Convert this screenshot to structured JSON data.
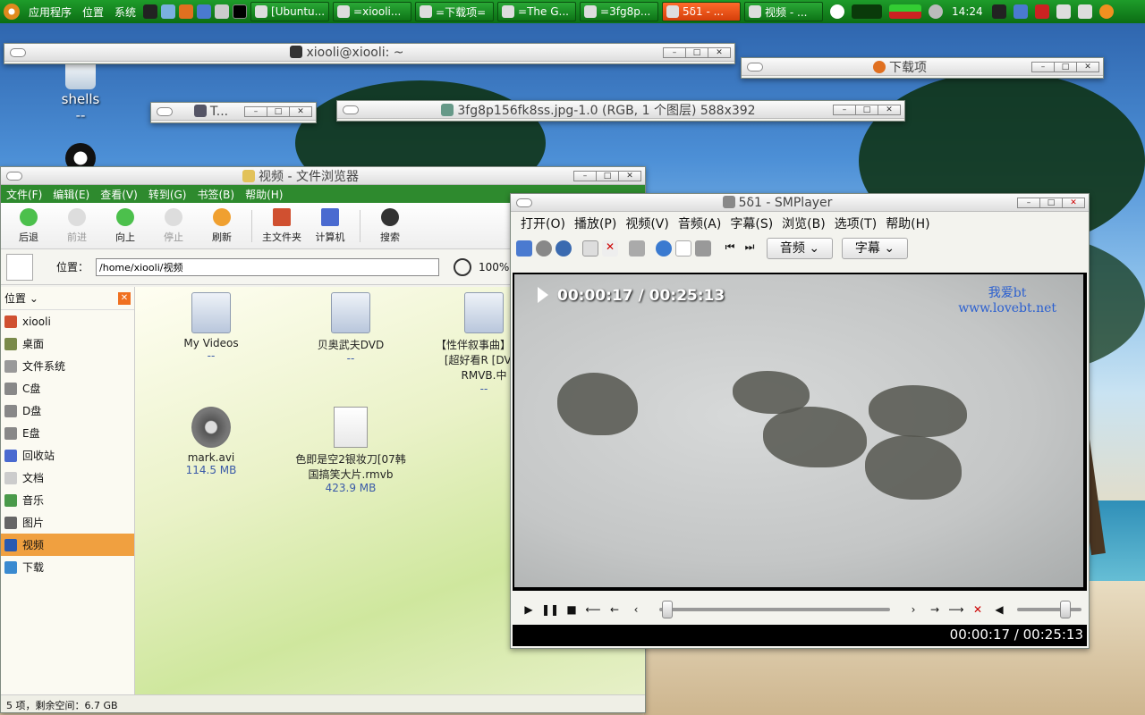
{
  "panel": {
    "menus": [
      "应用程序",
      "位置",
      "系统"
    ],
    "tasks": [
      "[Ubuntu...",
      "=xiooli...",
      "=下载项=",
      "=The G...",
      "=3fg8p...",
      "5δ1 - ...",
      "视频 - ..."
    ],
    "clock": "14:24"
  },
  "desktop": {
    "icon_label": "shells",
    "icon_sub": "--"
  },
  "windows": {
    "terminal_title": "xiooli@xiooli: ~",
    "downloads_title": "下载项",
    "small_title": "T...",
    "gimp_title": "3fg8p156fk8ss.jpg-1.0 (RGB, 1 个图层) 588x392"
  },
  "filebrowser": {
    "title": "视频 - 文件浏览器",
    "menu": [
      "文件(F)",
      "编辑(E)",
      "查看(V)",
      "转到(G)",
      "书签(B)",
      "帮助(H)"
    ],
    "toolbar": {
      "back": "后退",
      "forward": "前进",
      "up": "向上",
      "stop": "停止",
      "refresh": "刷新",
      "home": "主文件夹",
      "computer": "计算机",
      "search": "搜索"
    },
    "location_label": "位置：",
    "location_value": "/home/xiooli/视频",
    "zoom": "100%",
    "sidebar_title": "位置",
    "places": [
      "xiooli",
      "桌面",
      "文件系统",
      "C盘",
      "D盘",
      "E盘",
      "回收站",
      "文档",
      "音乐",
      "图片",
      "视频",
      "下载"
    ],
    "files": [
      {
        "name": "My Videos",
        "size": "--"
      },
      {
        "name": "贝奥武夫DVD",
        "size": "--"
      },
      {
        "name": "【性伴叙事曲】主】[超好看R [DVD-RMVB.中",
        "size": "--"
      },
      {
        "name": "mark.avi",
        "size": "114.5 MB"
      },
      {
        "name": "色即是空2银妆刀[07韩国搞笑大片.rmvb",
        "size": "423.9 MB"
      }
    ],
    "status": "5 项，剩余空间：6.7 GB"
  },
  "smplayer": {
    "title": "5δ1 - SMPlayer",
    "menu": [
      "打开(O)",
      "播放(P)",
      "视频(V)",
      "音频(A)",
      "字幕(S)",
      "浏览(B)",
      "选项(T)",
      "帮助(H)"
    ],
    "audio_btn": "音频",
    "subtitle_btn": "字幕",
    "osd_time": "00:00:17 / 00:25:13",
    "watermark_line1": "我爱bt",
    "watermark_line2": "www.lovebt.net",
    "time_display": "00:00:17 / 00:25:13",
    "seek_progress": 0.0113,
    "volume_level": 0.8
  }
}
